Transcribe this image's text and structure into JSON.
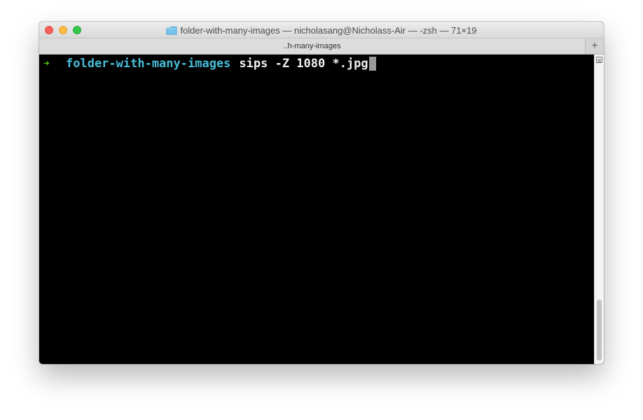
{
  "window": {
    "title": "folder-with-many-images — nicholasang@Nicholass-Air — -zsh — 71×19",
    "tab_label": "..h-many-images",
    "new_tab": "+"
  },
  "terminal": {
    "prompt_icon": "arrow-icon",
    "prompt_symbol": "➜",
    "directory": "folder-with-many-images",
    "command": "sips -Z 1080 *.jpg"
  },
  "colors": {
    "prompt_arrow": "#57d41a",
    "directory": "#48bcd8",
    "command": "#f0f0f0",
    "background": "#000000"
  },
  "icons": {
    "folder": "folder-icon",
    "scroll": "scrollbar-icon"
  }
}
